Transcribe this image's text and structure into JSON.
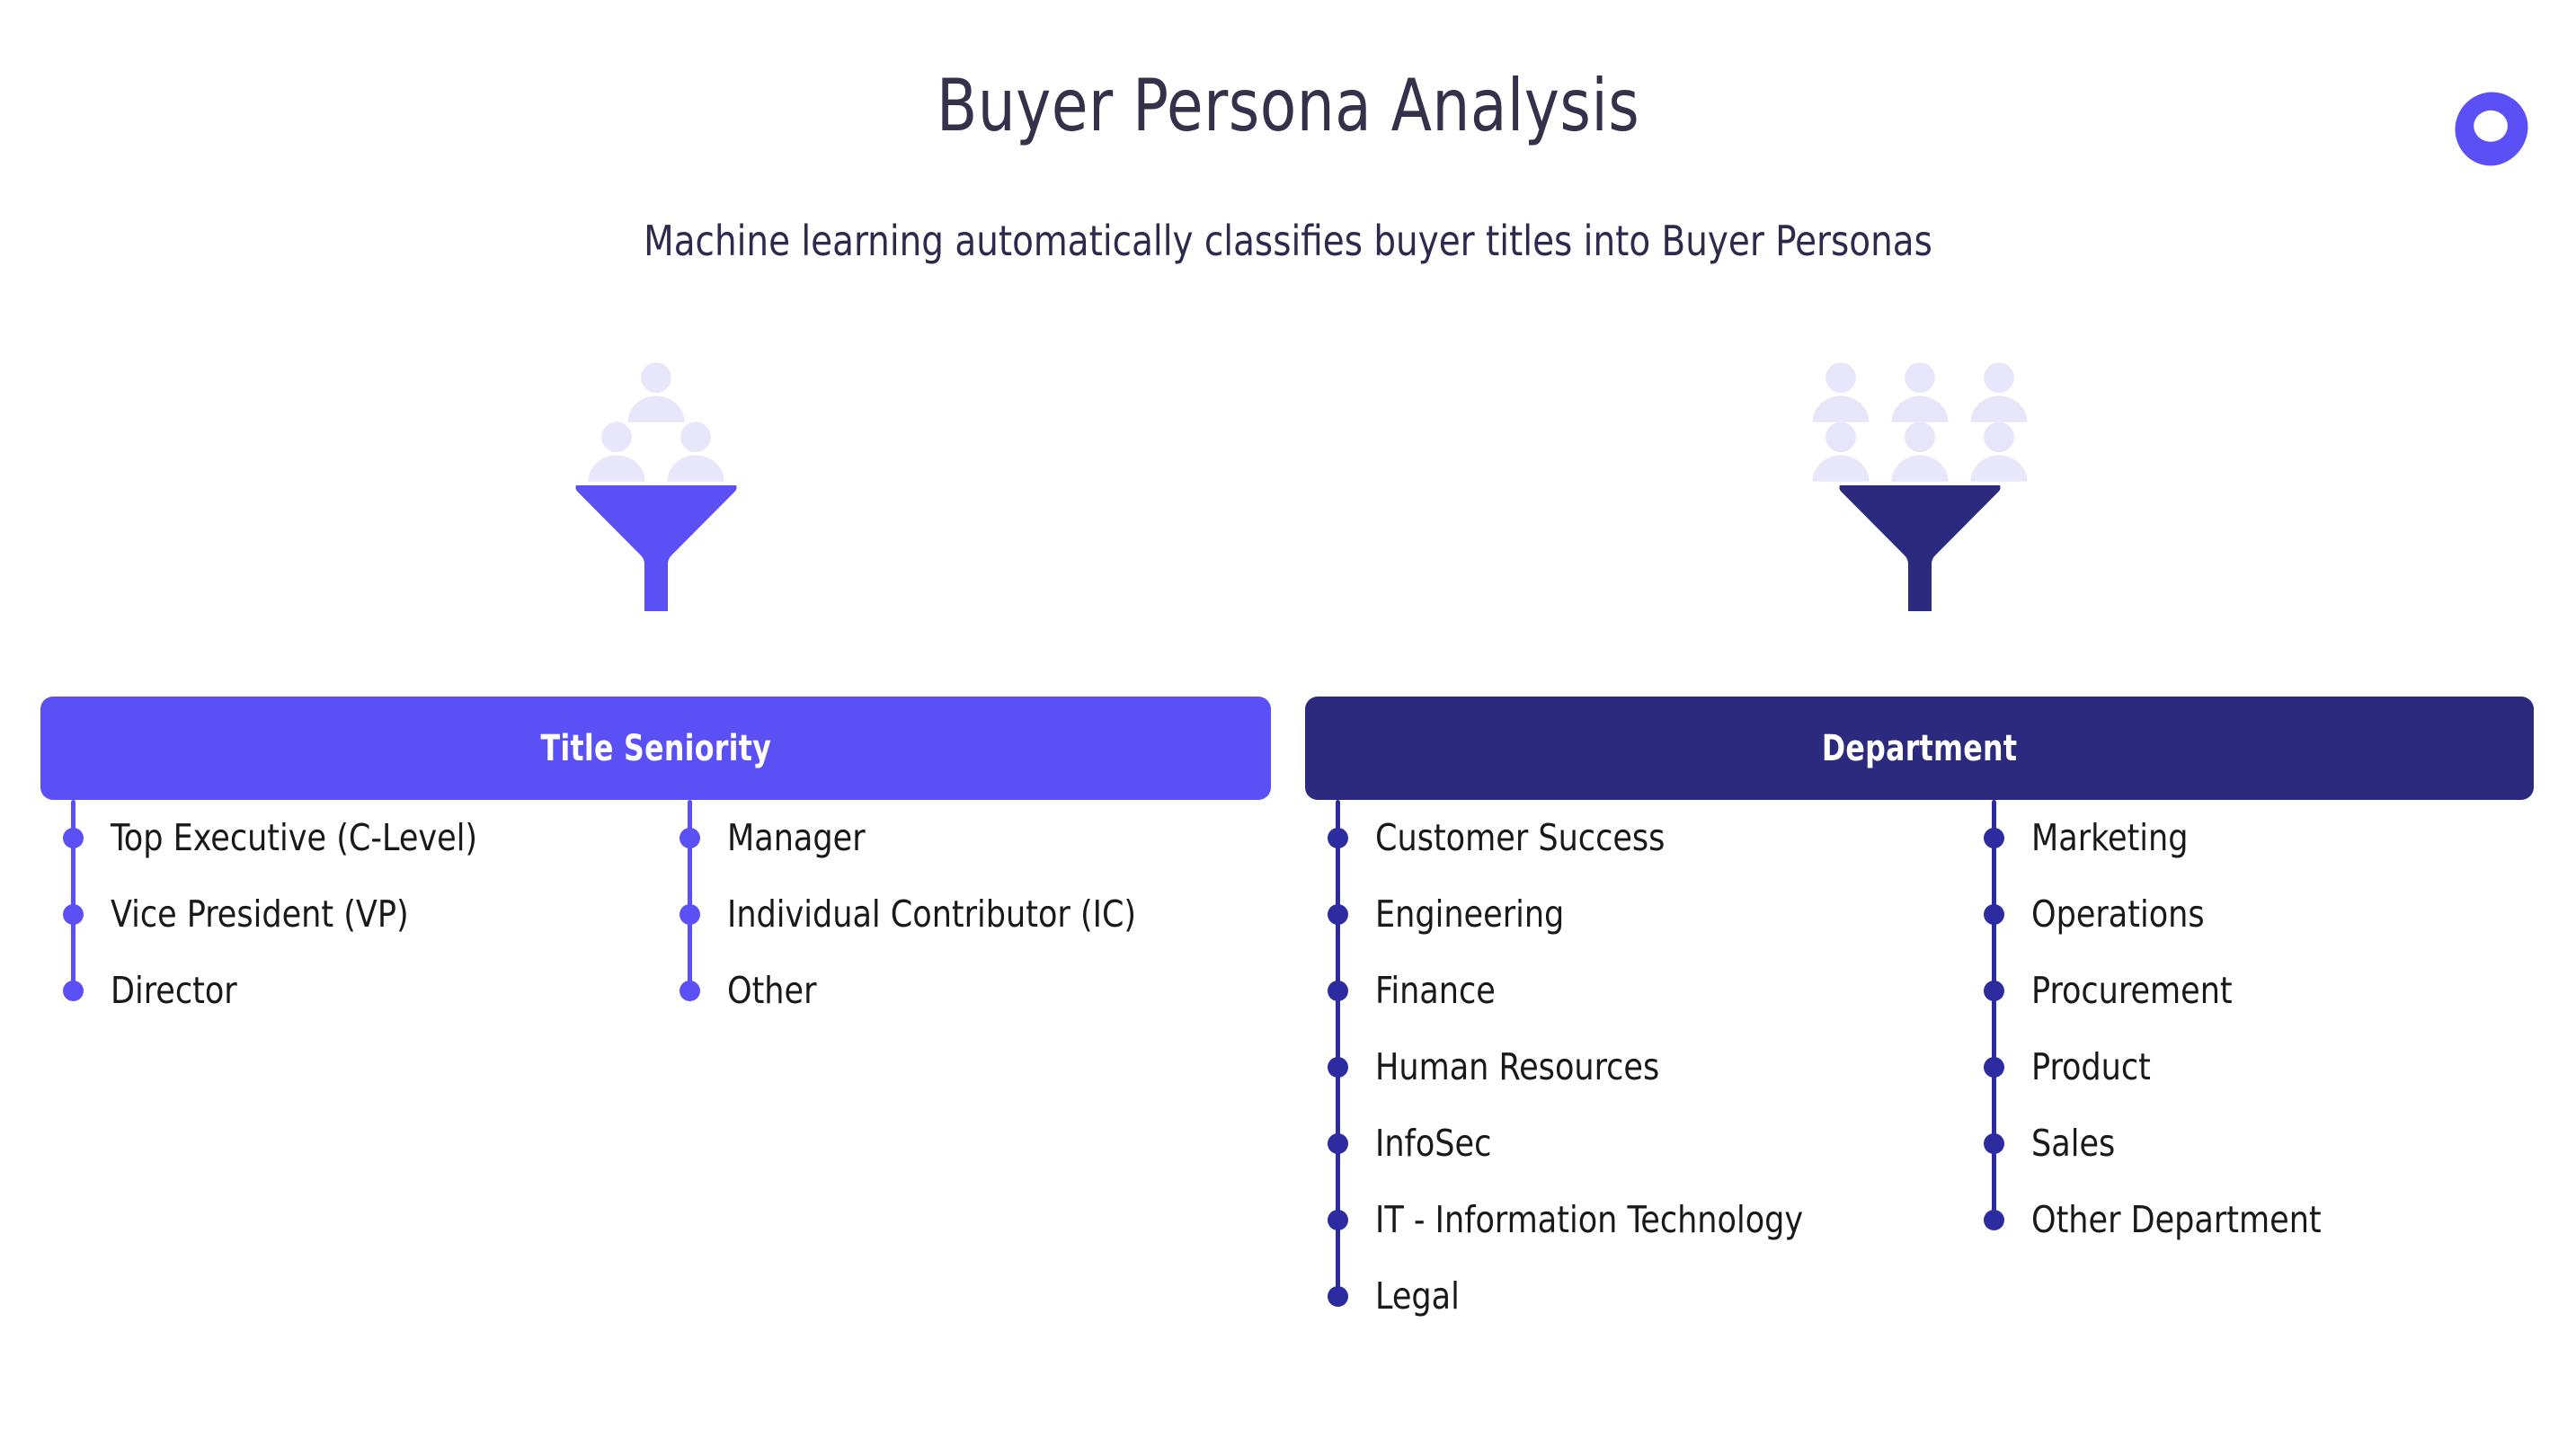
{
  "header": {
    "title": "Buyer Persona Analysis",
    "subtitle": "Machine learning automatically classifies buyer titles into Buyer Personas",
    "logo_name": "brand-blob-logo"
  },
  "colors": {
    "accent_bright": "#5A50F5",
    "accent_dark": "#2B2A7E",
    "rail_dark": "#2D2BA0",
    "person_icon": "#E7E6FA",
    "title_text": "#34314B",
    "subtitle_text": "#2C2A4D",
    "item_text": "#191919",
    "banner_text": "#FFFFFF",
    "background": "#FFFFFF"
  },
  "panels": [
    {
      "id": "seniority",
      "banner_label": "Title Seniority",
      "funnel_icon": "funnel-icon",
      "people_count": 3,
      "people_rows": [
        1,
        2
      ],
      "columns": [
        {
          "items": [
            "Top Executive (C-Level)",
            "Vice President (VP)",
            "Director"
          ]
        },
        {
          "items": [
            "Manager",
            "Individual Contributor (IC)",
            "Other"
          ]
        }
      ]
    },
    {
      "id": "department",
      "banner_label": "Department",
      "funnel_icon": "funnel-icon",
      "people_count": 6,
      "people_rows": [
        3,
        3
      ],
      "columns": [
        {
          "items": [
            "Customer Success",
            "Engineering",
            "Finance",
            "Human Resources",
            "InfoSec",
            "IT - Information Technology",
            "Legal"
          ]
        },
        {
          "items": [
            "Marketing",
            "Operations",
            "Procurement",
            "Product",
            "Sales",
            "Other Department"
          ]
        }
      ]
    }
  ]
}
